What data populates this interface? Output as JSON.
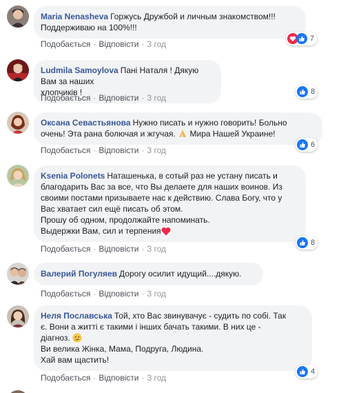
{
  "actions": {
    "like": "Подобається",
    "reply": "Відповісти",
    "separator": "·"
  },
  "colors": {
    "author": "#385898",
    "bubble": "#f2f3f5",
    "like_blue": "#1877f2",
    "love_red": "#f0284a"
  },
  "comments": [
    {
      "author": "Maria Nenasheva",
      "text": "Горжусь Дружбой и личным знакомством!!!\nПоддерживаю на 100%!!!",
      "time": "3 год",
      "reactions": {
        "icons": [
          "love-icon",
          "like-icon"
        ],
        "count": "7"
      }
    },
    {
      "author": "Ludmila Samoylova",
      "text": "Пані Наталя ! Дякую Вам за наших\nхлопчиків !",
      "time": "3 год",
      "reactions": {
        "icons": [
          "like-icon"
        ],
        "count": "8"
      }
    },
    {
      "author": "Оксана Севастьянова",
      "text_before": "Нужно писать и нужно говорить! Больно\nочень! Эта рана болючая и жгучая. ",
      "text_after": " Мира Нашей Украине!",
      "time": "3 год",
      "reactions": {
        "icons": [
          "like-icon"
        ],
        "count": "6"
      }
    },
    {
      "author": "Ksenia Polonets",
      "text": "Наташенька, в сотый раз не устану писать и\nблагодарить Вас за все, что Вы делаете для наших воинов. Из\nсвоими постами призываете нас к действию. Слава Богу, что у\nВас хватает сил ещё писать об этом.\nПрошу об одном, продолжайте напоминать.\nВыдержки Вам, сил и терпения",
      "time": "3 год",
      "reactions": {
        "icons": [
          "like-icon"
        ],
        "count": "8"
      }
    },
    {
      "author": "Валерий Погуляев",
      "text": "Дорогу осилит идущий....дякую.",
      "time": "3 год"
    },
    {
      "author": "Неля Пославська",
      "text_before": "Той, хто Вас звинувачує - судить по собі. Так\nє. Вони а житті є такими і інших бачать такими. В них це -\nдіагноз. ",
      "text_after": "\nВи велика Жінка, Мама, Подруга, Людина.\nХай вам щастить!",
      "time": "3 год",
      "reactions": {
        "icons": [
          "like-icon"
        ],
        "count": "4"
      }
    }
  ]
}
